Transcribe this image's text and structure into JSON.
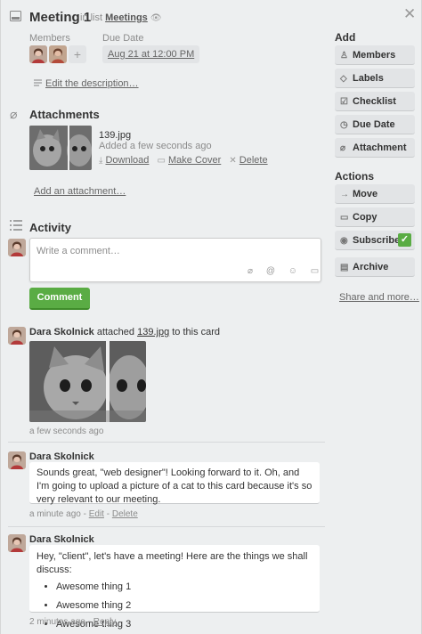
{
  "card": {
    "title": "Meeting 1",
    "in_list_prefix": "in list",
    "list_name": "Meetings"
  },
  "members": {
    "label": "Members",
    "add_symbol": "+"
  },
  "due_date": {
    "label": "Due Date",
    "value": "Aug 21 at 12:00 PM"
  },
  "description": {
    "edit_link": "Edit the description…"
  },
  "attachments": {
    "heading": "Attachments",
    "file": {
      "name": "139.jpg",
      "added": "Added a few seconds ago",
      "download": "Download",
      "make_cover": "Make Cover",
      "delete": "Delete"
    },
    "add_link": "Add an attachment…"
  },
  "activity": {
    "heading": "Activity",
    "comment_placeholder": "Write a comment…",
    "comment_button": "Comment",
    "items": [
      {
        "author": "Dara Skolnick",
        "action_prefix": "attached",
        "file": "139.jpg",
        "action_suffix": "to this card",
        "time": "a few seconds ago"
      },
      {
        "author": "Dara Skolnick",
        "text": "Sounds great, \"web designer\"! Looking forward to it. Oh, and I'm going to upload a picture of a cat to this card because it's so very relevant to our meeting.",
        "time": "a minute ago",
        "edit": "Edit",
        "delete": "Delete"
      },
      {
        "author": "Dara Skolnick",
        "text": "Hey, \"client\", let's have a meeting! Here are the things we shall discuss:",
        "list": [
          "Awesome thing 1",
          "Awesome thing 2",
          "Awesome thing 3"
        ],
        "time": "2 minutes ago",
        "reply": "Reply"
      }
    ]
  },
  "sidebar": {
    "add_heading": "Add",
    "add_buttons": [
      "Members",
      "Labels",
      "Checklist",
      "Due Date",
      "Attachment"
    ],
    "actions_heading": "Actions",
    "action_buttons": [
      "Move",
      "Copy",
      "Subscribe",
      "Archive"
    ],
    "share_link": "Share and more…"
  },
  "colors": {
    "accent_green": "#5aac44",
    "background": "#edeff0",
    "button_gray": "#e2e4e6"
  }
}
